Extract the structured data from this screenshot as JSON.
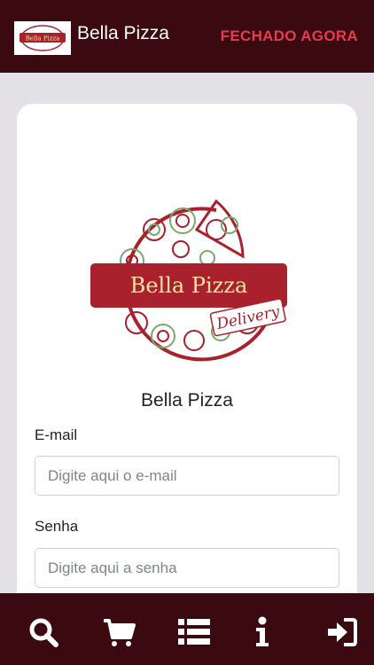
{
  "header": {
    "logo_text": "Bella Pizza",
    "title": "Bella Pizza",
    "status": "FECHADO AGORA"
  },
  "colors": {
    "brand_dark": "#3a0a10",
    "status_red": "#e63a50",
    "logo_red": "#a8212c",
    "logo_cream": "#f3e3a1"
  },
  "logo": {
    "name": "Bella Pizza",
    "tagline": "Delivery"
  },
  "login": {
    "shop_name": "Bella Pizza",
    "email_label": "E-mail",
    "email_placeholder": "Digite aqui o e-mail",
    "email_value": "",
    "password_label": "Senha",
    "password_placeholder": "Digite aqui a senha",
    "password_value": ""
  },
  "bottom_nav": [
    {
      "icon": "search-icon"
    },
    {
      "icon": "cart-icon"
    },
    {
      "icon": "list-icon"
    },
    {
      "icon": "info-icon"
    },
    {
      "icon": "sign-in-icon"
    }
  ]
}
